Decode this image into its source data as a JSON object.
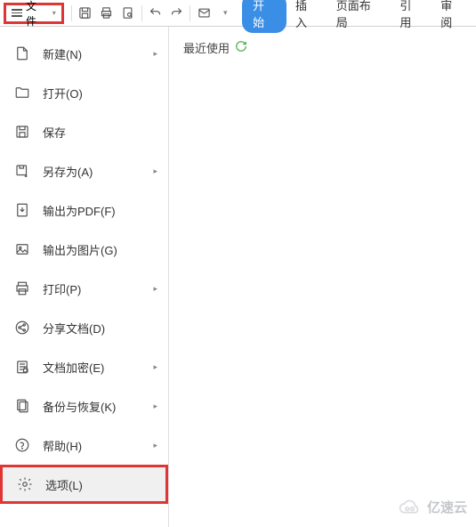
{
  "toolbar": {
    "file_label": "文件",
    "tabs": [
      "开始",
      "插入",
      "页面布局",
      "引用",
      "审阅"
    ],
    "active_tab_index": 0
  },
  "menu": {
    "items": [
      {
        "label": "新建(N)",
        "submenu": true,
        "icon": "new-doc"
      },
      {
        "label": "打开(O)",
        "submenu": false,
        "icon": "open-folder"
      },
      {
        "label": "保存",
        "submenu": false,
        "icon": "save"
      },
      {
        "label": "另存为(A)",
        "submenu": true,
        "icon": "save-as"
      },
      {
        "label": "输出为PDF(F)",
        "submenu": false,
        "icon": "export-pdf"
      },
      {
        "label": "输出为图片(G)",
        "submenu": false,
        "icon": "export-image"
      },
      {
        "label": "打印(P)",
        "submenu": true,
        "icon": "print"
      },
      {
        "label": "分享文档(D)",
        "submenu": false,
        "icon": "share"
      },
      {
        "label": "文档加密(E)",
        "submenu": true,
        "icon": "encrypt"
      },
      {
        "label": "备份与恢复(K)",
        "submenu": true,
        "icon": "backup"
      },
      {
        "label": "帮助(H)",
        "submenu": true,
        "icon": "help"
      },
      {
        "label": "选项(L)",
        "submenu": false,
        "icon": "settings"
      }
    ],
    "highlighted_index": 11
  },
  "content": {
    "recent_label": "最近使用"
  },
  "watermark": "亿速云"
}
